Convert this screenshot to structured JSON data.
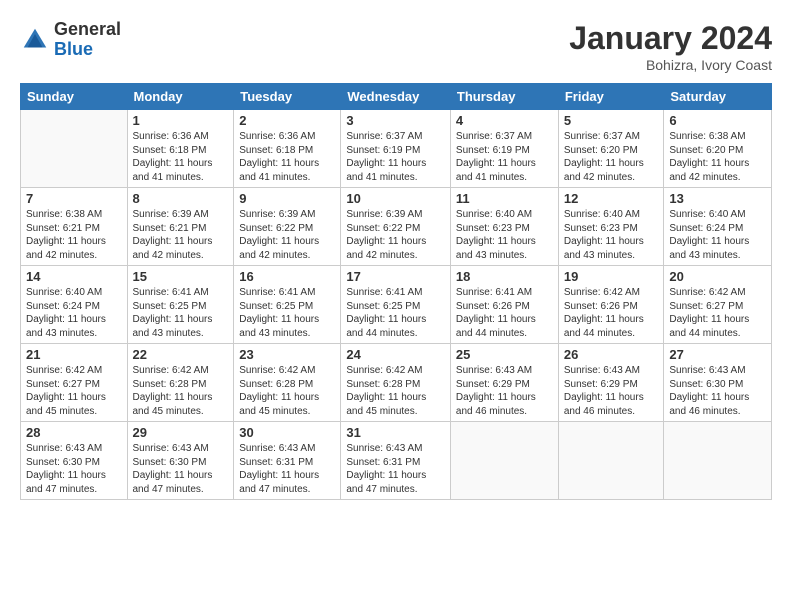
{
  "header": {
    "logo": {
      "line1": "General",
      "line2": "Blue"
    },
    "title": "January 2024",
    "subtitle": "Bohizra, Ivory Coast"
  },
  "weekdays": [
    "Sunday",
    "Monday",
    "Tuesday",
    "Wednesday",
    "Thursday",
    "Friday",
    "Saturday"
  ],
  "weeks": [
    [
      {
        "day": "",
        "sunrise": "",
        "sunset": "",
        "daylight": ""
      },
      {
        "day": "1",
        "sunrise": "Sunrise: 6:36 AM",
        "sunset": "Sunset: 6:18 PM",
        "daylight": "Daylight: 11 hours and 41 minutes."
      },
      {
        "day": "2",
        "sunrise": "Sunrise: 6:36 AM",
        "sunset": "Sunset: 6:18 PM",
        "daylight": "Daylight: 11 hours and 41 minutes."
      },
      {
        "day": "3",
        "sunrise": "Sunrise: 6:37 AM",
        "sunset": "Sunset: 6:19 PM",
        "daylight": "Daylight: 11 hours and 41 minutes."
      },
      {
        "day": "4",
        "sunrise": "Sunrise: 6:37 AM",
        "sunset": "Sunset: 6:19 PM",
        "daylight": "Daylight: 11 hours and 41 minutes."
      },
      {
        "day": "5",
        "sunrise": "Sunrise: 6:37 AM",
        "sunset": "Sunset: 6:20 PM",
        "daylight": "Daylight: 11 hours and 42 minutes."
      },
      {
        "day": "6",
        "sunrise": "Sunrise: 6:38 AM",
        "sunset": "Sunset: 6:20 PM",
        "daylight": "Daylight: 11 hours and 42 minutes."
      }
    ],
    [
      {
        "day": "7",
        "sunrise": "Sunrise: 6:38 AM",
        "sunset": "Sunset: 6:21 PM",
        "daylight": "Daylight: 11 hours and 42 minutes."
      },
      {
        "day": "8",
        "sunrise": "Sunrise: 6:39 AM",
        "sunset": "Sunset: 6:21 PM",
        "daylight": "Daylight: 11 hours and 42 minutes."
      },
      {
        "day": "9",
        "sunrise": "Sunrise: 6:39 AM",
        "sunset": "Sunset: 6:22 PM",
        "daylight": "Daylight: 11 hours and 42 minutes."
      },
      {
        "day": "10",
        "sunrise": "Sunrise: 6:39 AM",
        "sunset": "Sunset: 6:22 PM",
        "daylight": "Daylight: 11 hours and 42 minutes."
      },
      {
        "day": "11",
        "sunrise": "Sunrise: 6:40 AM",
        "sunset": "Sunset: 6:23 PM",
        "daylight": "Daylight: 11 hours and 43 minutes."
      },
      {
        "day": "12",
        "sunrise": "Sunrise: 6:40 AM",
        "sunset": "Sunset: 6:23 PM",
        "daylight": "Daylight: 11 hours and 43 minutes."
      },
      {
        "day": "13",
        "sunrise": "Sunrise: 6:40 AM",
        "sunset": "Sunset: 6:24 PM",
        "daylight": "Daylight: 11 hours and 43 minutes."
      }
    ],
    [
      {
        "day": "14",
        "sunrise": "Sunrise: 6:40 AM",
        "sunset": "Sunset: 6:24 PM",
        "daylight": "Daylight: 11 hours and 43 minutes."
      },
      {
        "day": "15",
        "sunrise": "Sunrise: 6:41 AM",
        "sunset": "Sunset: 6:25 PM",
        "daylight": "Daylight: 11 hours and 43 minutes."
      },
      {
        "day": "16",
        "sunrise": "Sunrise: 6:41 AM",
        "sunset": "Sunset: 6:25 PM",
        "daylight": "Daylight: 11 hours and 43 minutes."
      },
      {
        "day": "17",
        "sunrise": "Sunrise: 6:41 AM",
        "sunset": "Sunset: 6:25 PM",
        "daylight": "Daylight: 11 hours and 44 minutes."
      },
      {
        "day": "18",
        "sunrise": "Sunrise: 6:41 AM",
        "sunset": "Sunset: 6:26 PM",
        "daylight": "Daylight: 11 hours and 44 minutes."
      },
      {
        "day": "19",
        "sunrise": "Sunrise: 6:42 AM",
        "sunset": "Sunset: 6:26 PM",
        "daylight": "Daylight: 11 hours and 44 minutes."
      },
      {
        "day": "20",
        "sunrise": "Sunrise: 6:42 AM",
        "sunset": "Sunset: 6:27 PM",
        "daylight": "Daylight: 11 hours and 44 minutes."
      }
    ],
    [
      {
        "day": "21",
        "sunrise": "Sunrise: 6:42 AM",
        "sunset": "Sunset: 6:27 PM",
        "daylight": "Daylight: 11 hours and 45 minutes."
      },
      {
        "day": "22",
        "sunrise": "Sunrise: 6:42 AM",
        "sunset": "Sunset: 6:28 PM",
        "daylight": "Daylight: 11 hours and 45 minutes."
      },
      {
        "day": "23",
        "sunrise": "Sunrise: 6:42 AM",
        "sunset": "Sunset: 6:28 PM",
        "daylight": "Daylight: 11 hours and 45 minutes."
      },
      {
        "day": "24",
        "sunrise": "Sunrise: 6:42 AM",
        "sunset": "Sunset: 6:28 PM",
        "daylight": "Daylight: 11 hours and 45 minutes."
      },
      {
        "day": "25",
        "sunrise": "Sunrise: 6:43 AM",
        "sunset": "Sunset: 6:29 PM",
        "daylight": "Daylight: 11 hours and 46 minutes."
      },
      {
        "day": "26",
        "sunrise": "Sunrise: 6:43 AM",
        "sunset": "Sunset: 6:29 PM",
        "daylight": "Daylight: 11 hours and 46 minutes."
      },
      {
        "day": "27",
        "sunrise": "Sunrise: 6:43 AM",
        "sunset": "Sunset: 6:30 PM",
        "daylight": "Daylight: 11 hours and 46 minutes."
      }
    ],
    [
      {
        "day": "28",
        "sunrise": "Sunrise: 6:43 AM",
        "sunset": "Sunset: 6:30 PM",
        "daylight": "Daylight: 11 hours and 47 minutes."
      },
      {
        "day": "29",
        "sunrise": "Sunrise: 6:43 AM",
        "sunset": "Sunset: 6:30 PM",
        "daylight": "Daylight: 11 hours and 47 minutes."
      },
      {
        "day": "30",
        "sunrise": "Sunrise: 6:43 AM",
        "sunset": "Sunset: 6:31 PM",
        "daylight": "Daylight: 11 hours and 47 minutes."
      },
      {
        "day": "31",
        "sunrise": "Sunrise: 6:43 AM",
        "sunset": "Sunset: 6:31 PM",
        "daylight": "Daylight: 11 hours and 47 minutes."
      },
      {
        "day": "",
        "sunrise": "",
        "sunset": "",
        "daylight": ""
      },
      {
        "day": "",
        "sunrise": "",
        "sunset": "",
        "daylight": ""
      },
      {
        "day": "",
        "sunrise": "",
        "sunset": "",
        "daylight": ""
      }
    ]
  ]
}
